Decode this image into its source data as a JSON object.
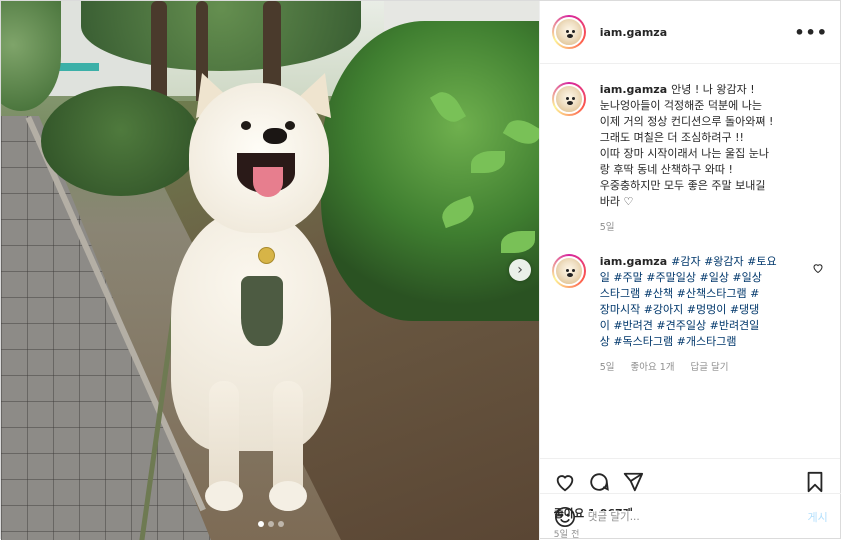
{
  "post": {
    "username": "iam.gamza",
    "more_label": "•••",
    "caption": {
      "username": "iam.gamza",
      "lines": [
        "안녕 ! 나 왕감자 !",
        "눈나엉아들이 걱정해준 덕분에 나는",
        "이제 거의 정상 컨디션으루 돌아와쪄 !",
        "그래도 며칠은 더 조심하려구 !!",
        "이따 장마 시작이래서 나는 울집 눈나",
        "랑 후딱 동네 산책하구 와따 !",
        "우중충하지만 모두 좋은 주말 보내길",
        "바라 ♡"
      ],
      "time": "5일"
    },
    "comment": {
      "username": "iam.gamza",
      "lines": [
        "#감자 #왕감자 #토요",
        "일 #주말 #주말일상 #일상 #일상",
        "스타그램 #산책 #산책스타그램 #",
        "장마시작 #강아지 #멍멍이 #댕댕",
        "이 #반려견 #견주일상 #반려견일",
        "상 #독스타그램 #개스타그램"
      ],
      "time": "5일",
      "likes": "좋아요 1개",
      "reply": "답글 달기"
    },
    "likes_count": "좋아요 1,067개",
    "posted_ago": "5일 전",
    "comment_input_placeholder": "댓글 달기...",
    "post_button": "게시"
  },
  "carousel": {
    "total_images": 3,
    "active_index": 0
  },
  "colors": {
    "text": "#262626",
    "muted": "#8e8e8e",
    "hashtag": "#00376b",
    "post_button_disabled": "#b2dffc",
    "border": "#efefef"
  },
  "icons": {
    "like": "heart-icon",
    "comment": "comment-icon",
    "share": "paper-plane-icon",
    "save": "bookmark-icon",
    "emoji": "smiley-icon",
    "more": "ellipsis-icon",
    "next": "chevron-right-icon"
  }
}
